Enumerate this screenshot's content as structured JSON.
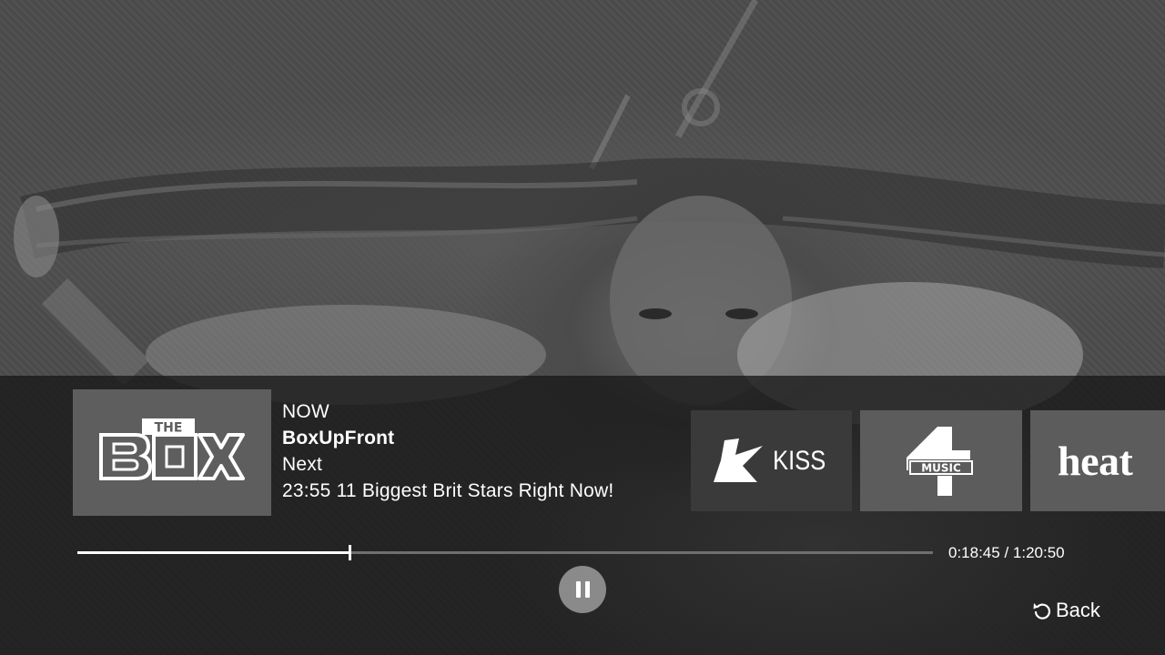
{
  "now_playing": {
    "channel_logo_text": "THE BOX",
    "now_label": "NOW",
    "now_title": "BoxUpFront",
    "next_label": "Next",
    "next_title": "23:55 11 Biggest Brit Stars Right Now!"
  },
  "channels": [
    {
      "name": "KISS",
      "logo_text": "KISS"
    },
    {
      "name": "4Music",
      "logo_text": "MUSIC"
    },
    {
      "name": "heat",
      "logo_text": "heat"
    }
  ],
  "playback": {
    "elapsed": "0:18:45",
    "duration": "1:20:50",
    "time_text": "0:18:45 / 1:20:50",
    "progress_fraction": 0.319,
    "state": "playing",
    "control_icon": "pause-icon"
  },
  "navigation": {
    "back_label": "Back",
    "back_icon": "back-arrow-icon"
  },
  "colors": {
    "overlay": "#181818",
    "text": "#ffffff",
    "progress_track": "#6f6f6f",
    "progress_fill": "#ffffff"
  }
}
